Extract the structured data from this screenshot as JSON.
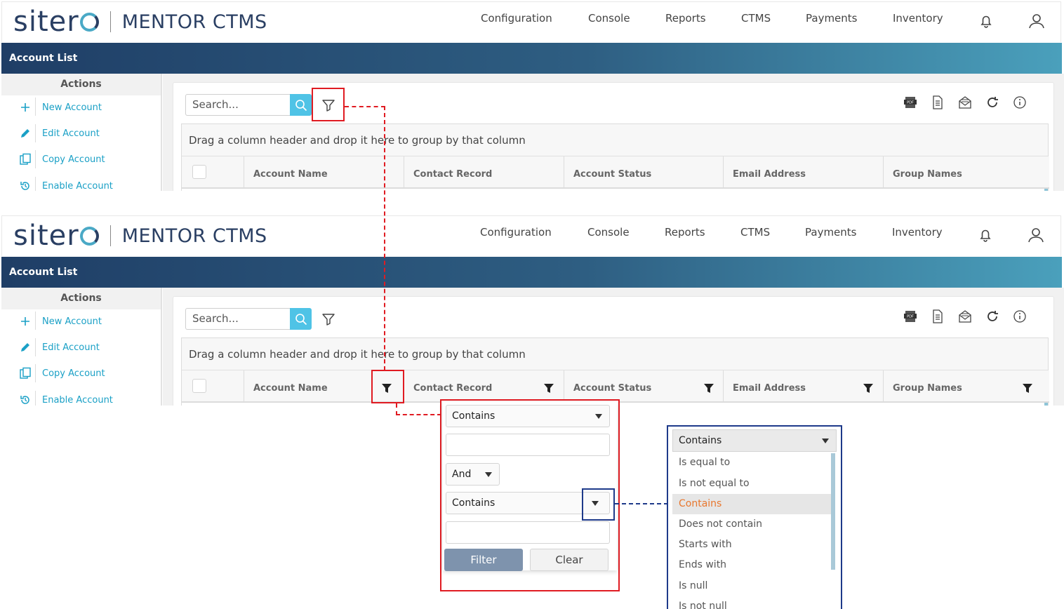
{
  "app": {
    "brand": "sitero",
    "product_light": "MENTOR ",
    "product_bold": "CTMS"
  },
  "nav": [
    "Configuration",
    "Console",
    "Reports",
    "CTMS",
    "Payments",
    "Inventory"
  ],
  "page_title": "Account List",
  "sidebar": {
    "heading": "Actions",
    "items": [
      {
        "label": "New Account",
        "icon": "plus-icon"
      },
      {
        "label": "Edit Account",
        "icon": "pencil-icon"
      },
      {
        "label": "Copy Account",
        "icon": "copy-icon"
      },
      {
        "label": "Enable Account",
        "icon": "restore-icon"
      }
    ]
  },
  "toolbar": {
    "search_placeholder": "Search...",
    "icons": [
      "pdf-export-icon",
      "document-export-icon",
      "email-icon",
      "refresh-icon",
      "info-icon"
    ]
  },
  "grid": {
    "group_hint": "Drag a column header and drop it here to group by that column",
    "columns": [
      "Account Name",
      "Contact Record",
      "Account Status",
      "Email Address",
      "Group Names"
    ]
  },
  "filter_popup": {
    "operator1": "Contains",
    "value1": "",
    "logic": "And",
    "operator2": "Contains",
    "value2": "",
    "filter_label": "Filter",
    "clear_label": "Clear"
  },
  "operator_list": {
    "selected": "Contains",
    "options": [
      "Is equal to",
      "Is not equal to",
      "Contains",
      "Does not contain",
      "Starts with",
      "Ends with",
      "Is null",
      "Is not null"
    ],
    "active_index": 2
  },
  "colors": {
    "accent": "#1aa0c6",
    "highlight_red": "#e01b22",
    "highlight_blue": "#1e3a8a",
    "active_option": "#e8772e"
  }
}
